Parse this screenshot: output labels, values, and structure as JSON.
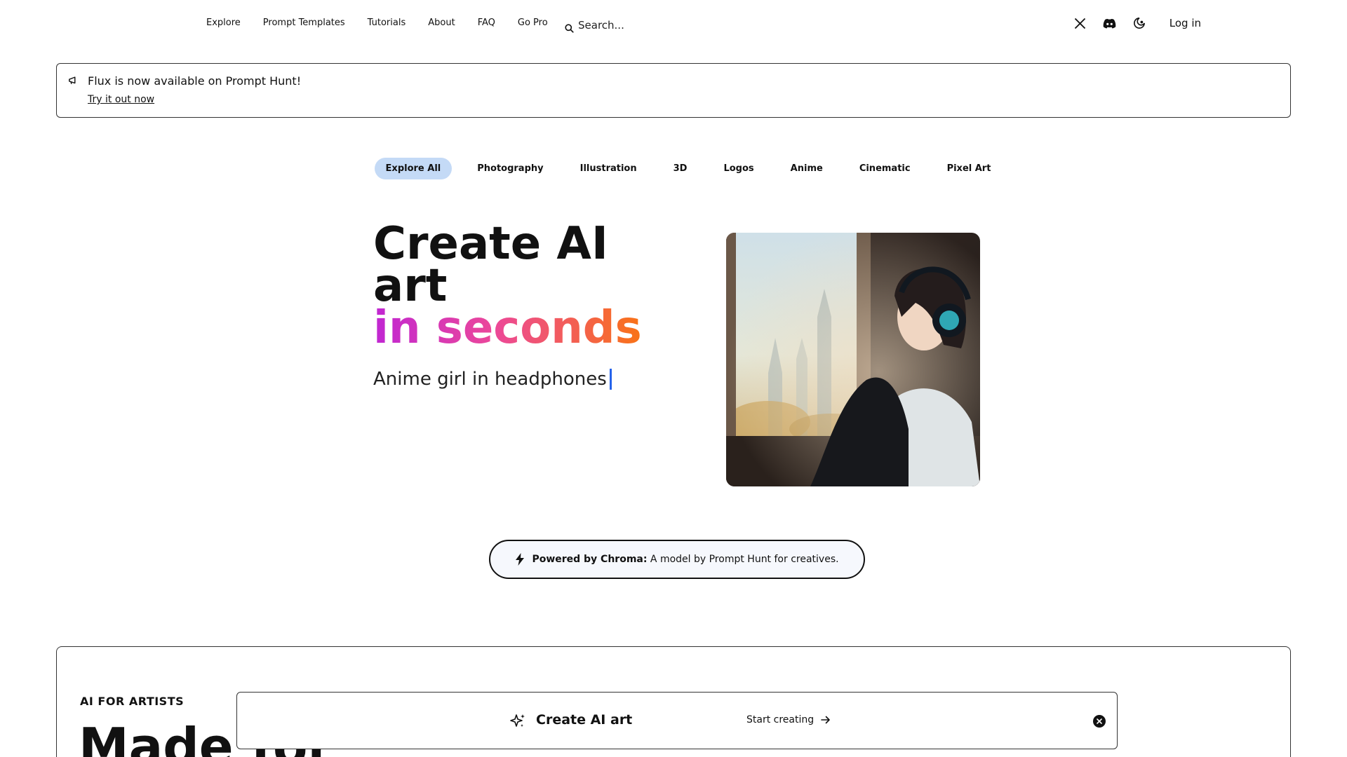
{
  "nav": {
    "links": [
      "Explore",
      "Prompt Templates",
      "Tutorials",
      "About",
      "FAQ",
      "Go Pro"
    ],
    "search_placeholder": "Search...",
    "icons": [
      "x-logo-icon",
      "discord-icon",
      "theme-toggle-icon"
    ],
    "login": "Log in"
  },
  "announcement": {
    "message": "Flux is now available on Prompt Hunt!",
    "cta": "Try it out now"
  },
  "tabs": [
    "Explore All",
    "Photography",
    "Illustration",
    "3D",
    "Logos",
    "Anime",
    "Cinematic",
    "Pixel Art"
  ],
  "active_tab": "Explore All",
  "hero": {
    "title_line1": "Create AI",
    "title_line2": "art",
    "title_line3": "in seconds",
    "typed_prompt": "Anime girl in headphones",
    "image_alt": "anime girl with headphones by a window"
  },
  "powered": {
    "bold": "Powered by Chroma:",
    "text": "A model by Prompt Hunt for creatives."
  },
  "section": {
    "eyebrow": "AI FOR ARTISTS",
    "heading": "Made for"
  },
  "create_bar": {
    "label": "Create AI art",
    "cta": "Start creating"
  },
  "colors": {
    "active_tab_bg": "#c4daf6",
    "gradient_start": "#c026d3",
    "gradient_mid": "#ec4899",
    "gradient_end": "#f97316",
    "caret": "#2563eb"
  }
}
